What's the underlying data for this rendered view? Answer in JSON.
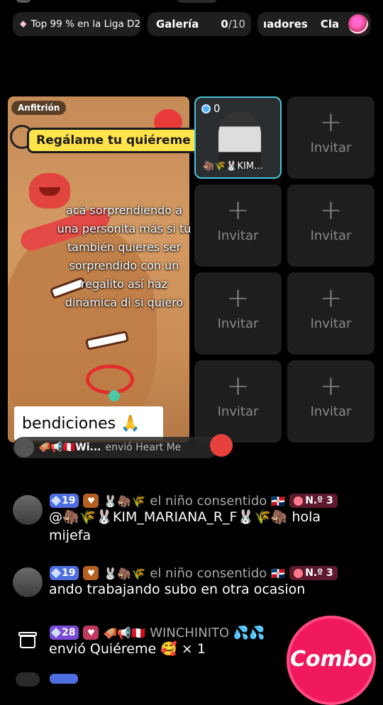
{
  "top_bar": {
    "league_label": "Top 99 % en la Liga D2",
    "gallery_label": "Galería",
    "gallery_count": "0",
    "gallery_total": "/10",
    "ranking_label_a": "ıadores",
    "ranking_label_b": "Cla"
  },
  "host": {
    "role_badge": "Anfitrión",
    "gift_request": "Regálame tu quiéreme",
    "caption": "acá sorprendiendo a una personita más si tú también quieres ser sorprendido con un regalito así haz dinámica di si quiero",
    "name_card": "bendiciones 🙏"
  },
  "guest": {
    "count": "0",
    "name": "🦣🌾🐰KIM..."
  },
  "invite_label": "Invitar",
  "invite_plus": "+",
  "gift_notice": {
    "sender": "🪗📢🇵🇪Wi...",
    "action": "envió Heart Me"
  },
  "chat": [
    {
      "level": "19",
      "emojis": "🐰🦣🌾",
      "nickname": "el niño consentido",
      "flag": "🇩🇴",
      "rank": "N.º 3",
      "text": "@🦣🌾🐰KIM_MARIANA_R_F🐰🌾🦣 hola mijefa"
    },
    {
      "level": "19",
      "emojis": "🐰🦣🌾",
      "nickname": "el niño consentido",
      "flag": "🇩🇴",
      "rank": "N.º 3",
      "text": "ando trabajando  subo en otra ocasion"
    },
    {
      "level": "28",
      "emojis": "🪗📢🇵🇪",
      "nickname": "WINCHINITO 💦💦",
      "text": "envió Quiéreme 🥰 × 1"
    }
  ],
  "combo_label": "Combo",
  "colors": {
    "background": "#000000",
    "seat": "#1e1e1e",
    "guest_border": "#47c5d8",
    "banner_yellow": "#ffe34a",
    "combo": "#f0195e",
    "level_blue": "#4f6fe0",
    "level_purple": "#7b4bd8"
  }
}
